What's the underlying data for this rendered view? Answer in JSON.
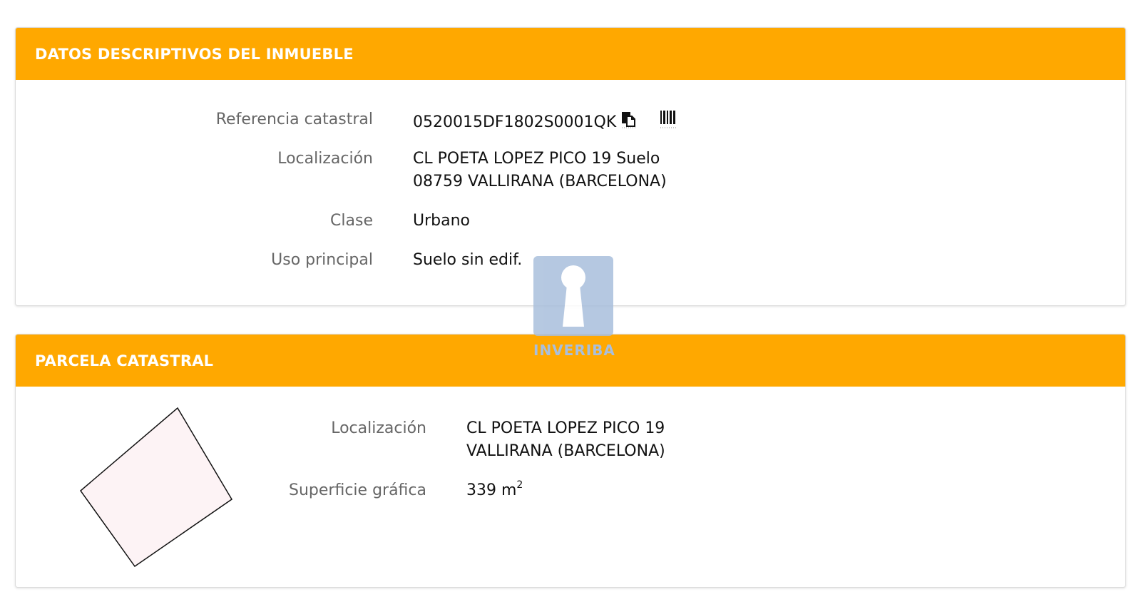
{
  "section1": {
    "title": "DATOS DESCRIPTIVOS DEL INMUEBLE",
    "rows": [
      {
        "label": "Referencia catastral",
        "value": "0520015DF1802S0001QK"
      },
      {
        "label": "Localización",
        "value_line1": "CL POETA LOPEZ PICO 19 Suelo",
        "value_line2": "08759 VALLIRANA (BARCELONA)"
      },
      {
        "label": "Clase",
        "value": "Urbano"
      },
      {
        "label": "Uso principal",
        "value": "Suelo sin edif."
      }
    ],
    "icons": [
      "copy-icon",
      "barcode-icon"
    ]
  },
  "section2": {
    "title": "PARCELA CATASTRAL",
    "rows": [
      {
        "label": "Localización",
        "value_line1": "CL POETA LOPEZ PICO 19",
        "value_line2": "VALLIRANA (BARCELONA)"
      },
      {
        "label": "Superficie gráfica",
        "value": "339 m",
        "unit_exponent": "2"
      }
    ]
  },
  "watermark": {
    "text": "INVERIBA",
    "color": "#a9bfdc"
  },
  "colors": {
    "header": "#ffa800",
    "parcel_fill": "#fdf3f5"
  }
}
